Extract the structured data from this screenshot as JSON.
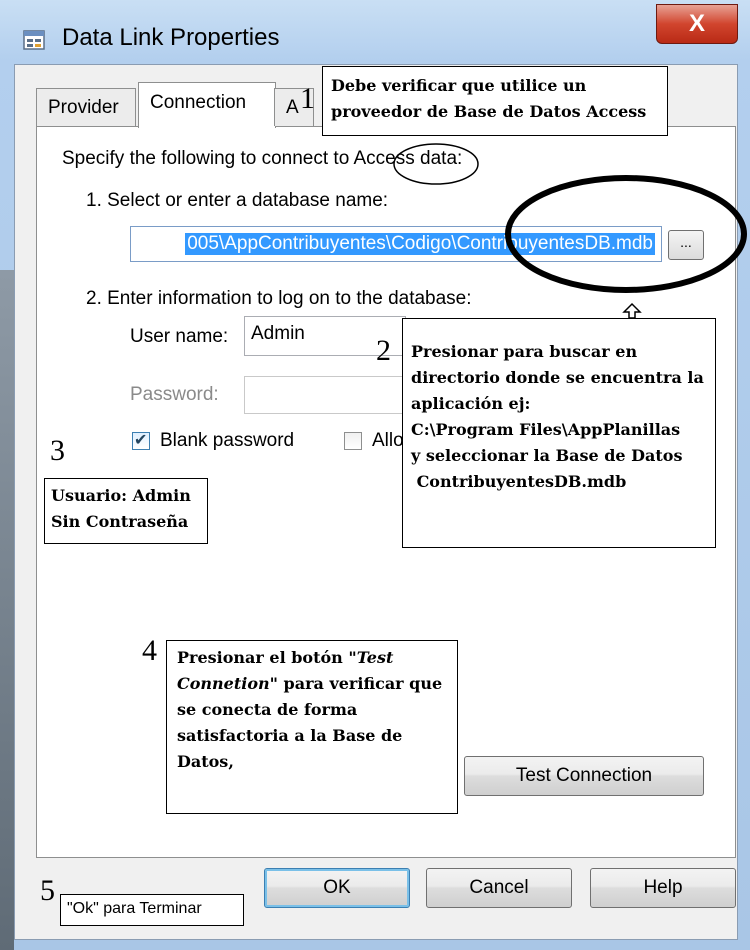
{
  "window": {
    "title": "Data Link Properties",
    "close_label": "X"
  },
  "tabs": [
    {
      "label": "Provider"
    },
    {
      "label": "Connection"
    },
    {
      "label": "A"
    }
  ],
  "connection": {
    "instruction": "Specify the following to connect to Access data:",
    "step1_label": "1. Select or enter a database name:",
    "database_path": "005\\AppContribuyentes\\Codigo\\ContribuyentesDB.mdb",
    "browse_label": "...",
    "step2_label": "2. Enter information to log on to the database:",
    "user_name_label": "User name:",
    "user_name_value": "Admin",
    "password_label": "Password:",
    "blank_password_label": "Blank password",
    "allow_saving_label": "Allo"
  },
  "buttons": {
    "test_connection": "Test Connection",
    "ok": "OK",
    "cancel": "Cancel",
    "help": "Help"
  },
  "annotations": {
    "step_numbers": [
      "1",
      "2",
      "3",
      "4",
      "5"
    ],
    "note1": [
      "Debe verificar que utilice un",
      "proveedor de Base de Datos Access"
    ],
    "note2": [
      "Presionar para buscar en",
      "directorio donde se encuentra la",
      "aplicación ej:",
      "C:\\Program Files\\AppPlanillas",
      "y seleccionar la Base de Datos",
      " ContribuyentesDB.mdb"
    ],
    "note3": [
      "Usuario: Admin",
      "Sin Contraseña"
    ],
    "note4_parts": [
      "Presionar el botón \"",
      "Test Connetion",
      "\" para verificar que se conecta de forma satisfactoria a la Base de Datos,"
    ],
    "note5": "\"Ok\" para Terminar"
  }
}
